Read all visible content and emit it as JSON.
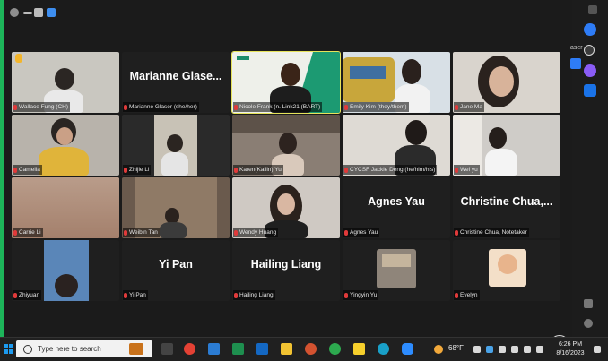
{
  "colors": {
    "accent": "#1db45a",
    "mic_muted": "#e03a3a",
    "active_speaker": "#e6e35a",
    "taskbar": "#202020"
  },
  "gallery": {
    "tiles": [
      {
        "name": "Wallace Fung (CH)",
        "type": "video"
      },
      {
        "name": "Marianne Glaser (she/her)",
        "type": "name",
        "display": "Marianne  Glase..."
      },
      {
        "name": "Nicole Frank (n. Link21 (BART)",
        "type": "video",
        "active": true
      },
      {
        "name": "Emily Kim (they/them)",
        "type": "video"
      },
      {
        "name": "Jane Ma",
        "type": "video"
      },
      {
        "name": "Camella",
        "type": "video"
      },
      {
        "name": "Zhijie Li",
        "type": "video"
      },
      {
        "name": "Karen(Kailin) Yu",
        "type": "video"
      },
      {
        "name": "CYCSF Jackie Deng (he/him/his)",
        "type": "video"
      },
      {
        "name": "Wei yu",
        "type": "video"
      },
      {
        "name": "Carrie Li",
        "type": "video"
      },
      {
        "name": "Weibin Tan",
        "type": "video"
      },
      {
        "name": "Wendy Huang",
        "type": "video"
      },
      {
        "name": "Agnes Yau",
        "type": "name",
        "display": "Agnes Yau"
      },
      {
        "name": "Christine Chua, Notetaker",
        "type": "name",
        "display": "Christine  Chua,..."
      },
      {
        "name": "Zhiyuan",
        "type": "video"
      },
      {
        "name": "Yi Pan",
        "type": "name",
        "display": "Yi Pan"
      },
      {
        "name": "Hailing Liang",
        "type": "name",
        "display": "Hailing Liang"
      },
      {
        "name": "Yingyin Yu",
        "type": "video"
      },
      {
        "name": "Evelyn",
        "type": "video"
      }
    ]
  },
  "side_panel": {
    "label": "aser"
  },
  "taskbar": {
    "search_placeholder": "Type here to search",
    "temperature": "68°F",
    "time": "6:26 PM",
    "date": "8/16/2023"
  }
}
